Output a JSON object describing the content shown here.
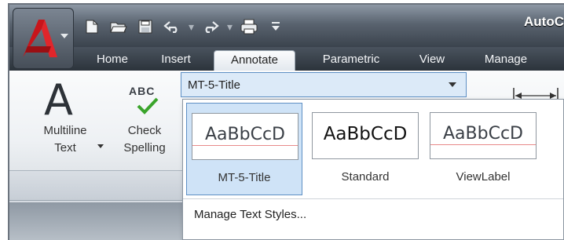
{
  "app": {
    "title": "AutoC"
  },
  "tabs": [
    {
      "label": "Home",
      "active": false
    },
    {
      "label": "Insert",
      "active": false
    },
    {
      "label": "Annotate",
      "active": true
    },
    {
      "label": "Parametric",
      "active": false
    },
    {
      "label": "View",
      "active": false
    },
    {
      "label": "Manage",
      "active": false
    }
  ],
  "quick_access": [
    "new-icon",
    "open-icon",
    "save-icon",
    "undo-icon",
    "redo-icon",
    "plot-icon",
    "dropdown-icon"
  ],
  "ribbon": {
    "multiline_text": {
      "line1": "Multiline",
      "line2": "Text",
      "icon": "A"
    },
    "check_spelling": {
      "line1": "Check",
      "line2": "Spelling",
      "icon_text": "ABC"
    }
  },
  "text_style": {
    "current": "MT-5-Title",
    "gallery": [
      {
        "name": "MT-5-Title",
        "sample": "AaBbCcD",
        "selected": true
      },
      {
        "name": "Standard",
        "sample": "AaBbCcD",
        "selected": false
      },
      {
        "name": "ViewLabel",
        "sample": "AaBbCcD",
        "selected": false
      }
    ],
    "manage_label": "Manage Text Styles..."
  },
  "colors": {
    "accent_red": "#c8151b",
    "selection_blue": "#cfe3f7",
    "check_green": "#3aa42b"
  }
}
